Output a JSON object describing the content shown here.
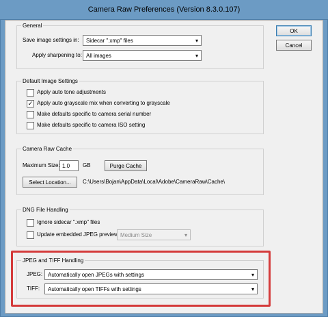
{
  "window": {
    "title": "Camera Raw Preferences  (Version 8.3.0.107)"
  },
  "buttons": {
    "ok": "OK",
    "cancel": "Cancel"
  },
  "general": {
    "legend": "General",
    "save_label": "Save image settings in:",
    "save_value": "Sidecar \".xmp\" files",
    "sharpen_label": "Apply sharpening to:",
    "sharpen_value": "All images"
  },
  "defaults": {
    "legend": "Default Image Settings",
    "items": [
      {
        "label": "Apply auto tone adjustments",
        "checked": false
      },
      {
        "label": "Apply auto grayscale mix when converting to grayscale",
        "checked": true
      },
      {
        "label": "Make defaults specific to camera serial number",
        "checked": false
      },
      {
        "label": "Make defaults specific to camera ISO setting",
        "checked": false
      }
    ]
  },
  "cache": {
    "legend": "Camera Raw Cache",
    "max_size_label": "Maximum Size:",
    "max_size_value": "1.0",
    "unit": "GB",
    "purge_button": "Purge Cache",
    "select_button": "Select Location...",
    "path": "C:\\Users\\Bojan\\AppData\\Local\\Adobe\\CameraRaw\\Cache\\"
  },
  "dng": {
    "legend": "DNG File Handling",
    "ignore_label": "Ignore sidecar \".xmp\" files",
    "update_label": "Update embedded JPEG previews:",
    "preview_value": "Medium Size"
  },
  "jpeg_tiff": {
    "legend": "JPEG and TIFF Handling",
    "jpeg_label": "JPEG:",
    "jpeg_value": "Automatically open JPEGs with settings",
    "tiff_label": "TIFF:",
    "tiff_value": "Automatically open TIFFs with settings"
  },
  "colors": {
    "frame": "#6c9bc4",
    "highlight": "#d43a3a"
  },
  "icons": {
    "dropdown": "chevron-down-icon",
    "check": "checkmark-icon"
  }
}
